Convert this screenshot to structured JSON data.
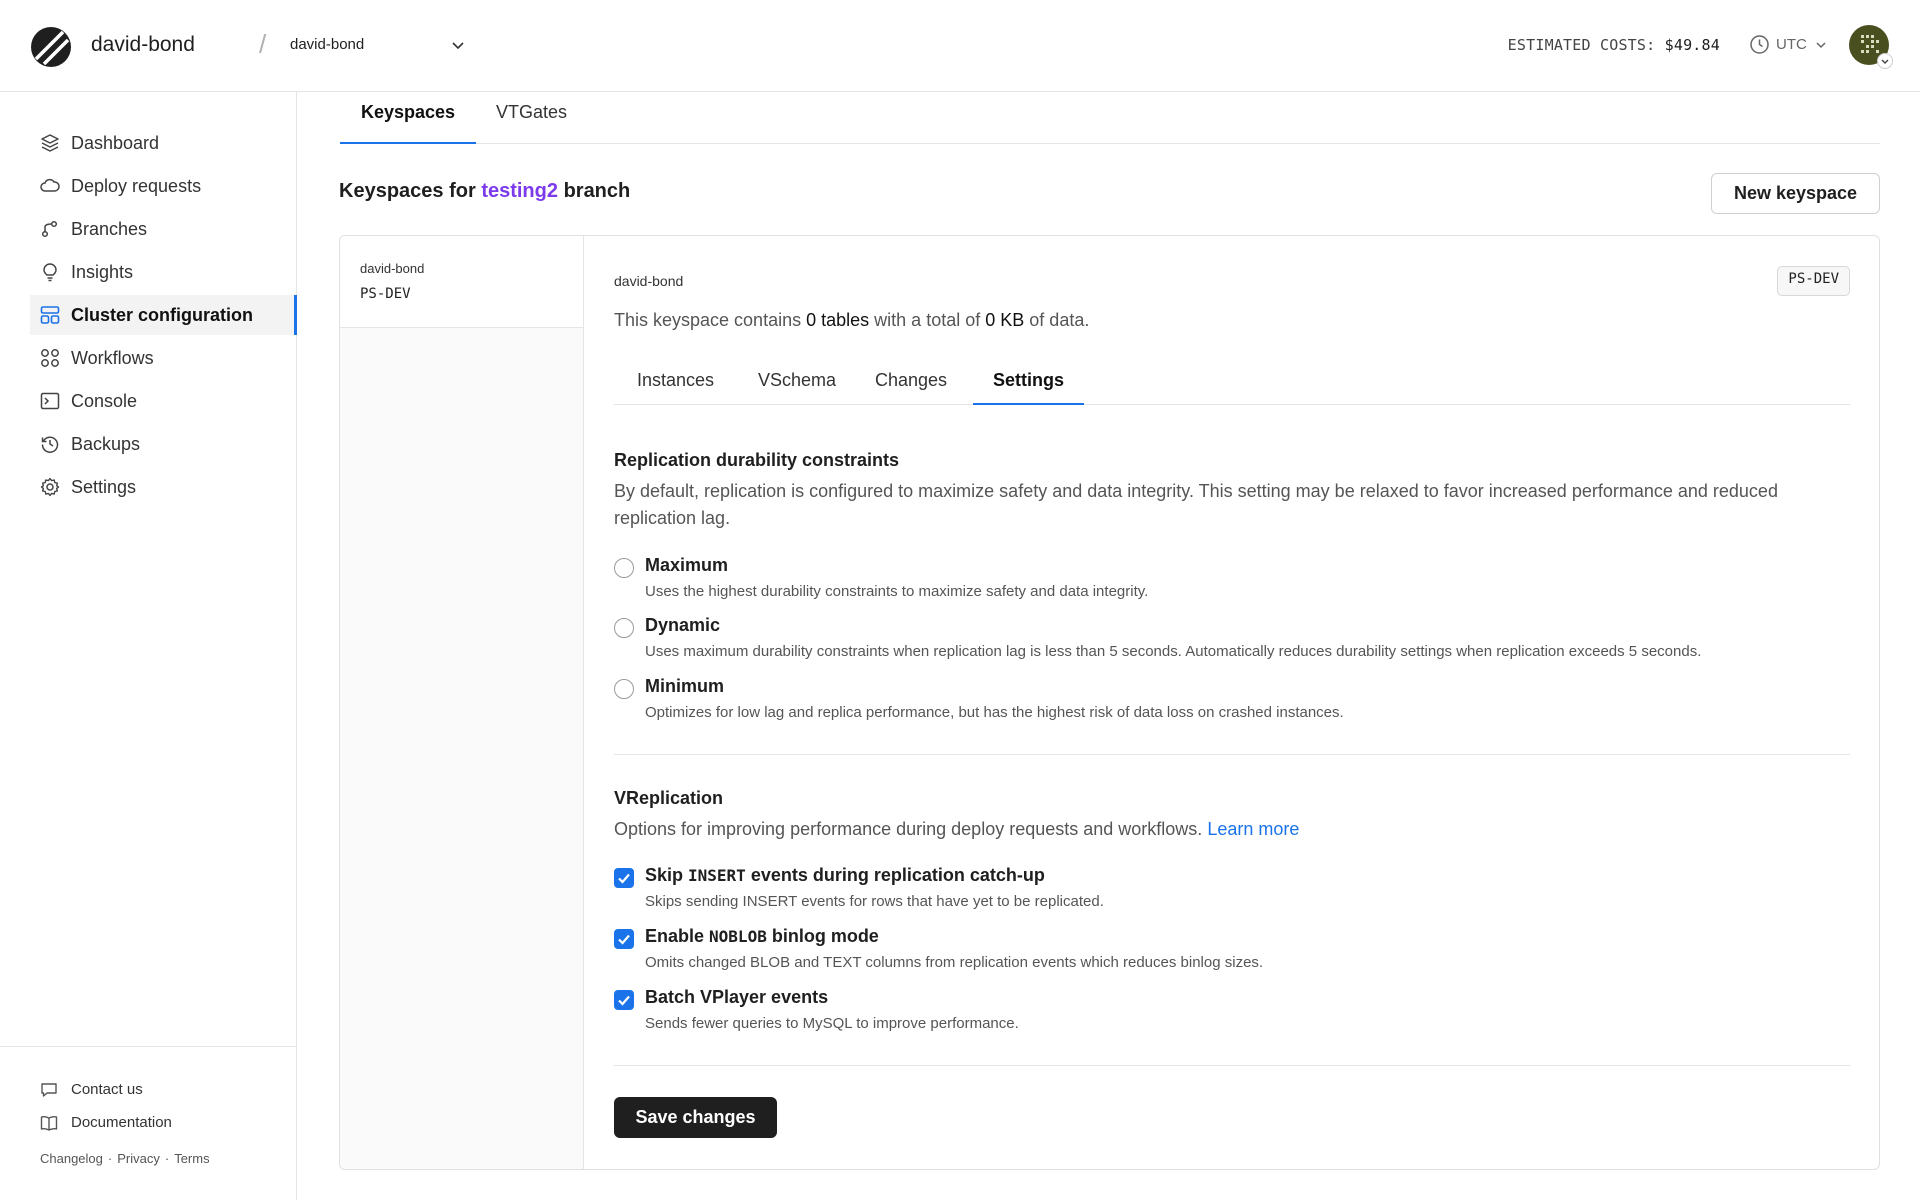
{
  "header": {
    "org_name": "david-bond",
    "separator": "/",
    "database_select": "david-bond",
    "costs_label": "ESTIMATED COSTS:",
    "costs_value": "$49.84",
    "timezone": "UTC",
    "colors": {
      "accent": "#1a73e8",
      "branch": "#7c3aed"
    }
  },
  "sidebar": {
    "items": [
      {
        "label": "Dashboard",
        "icon": "layers-icon"
      },
      {
        "label": "Deploy requests",
        "icon": "cloud-icon"
      },
      {
        "label": "Branches",
        "icon": "branch-icon"
      },
      {
        "label": "Insights",
        "icon": "lightbulb-icon"
      },
      {
        "label": "Cluster configuration",
        "icon": "cluster-icon",
        "active": true
      },
      {
        "label": "Workflows",
        "icon": "workflows-icon"
      },
      {
        "label": "Console",
        "icon": "terminal-icon"
      },
      {
        "label": "Backups",
        "icon": "history-icon"
      },
      {
        "label": "Settings",
        "icon": "gear-icon"
      }
    ],
    "footer": {
      "contact": "Contact us",
      "documentation": "Documentation",
      "changelog": "Changelog",
      "privacy": "Privacy",
      "terms": "Terms",
      "dot": "·"
    }
  },
  "main": {
    "tabs": [
      {
        "label": "Keyspaces",
        "active": true
      },
      {
        "label": "VTGates"
      }
    ],
    "heading_prefix": "Keyspaces for",
    "heading_branch": "testing2",
    "heading_suffix": "branch",
    "new_keyspace_button": "New keyspace"
  },
  "keyspace_list": [
    {
      "name": "david-bond",
      "tag": "PS-DEV"
    }
  ],
  "keyspace": {
    "name": "david-bond",
    "badge": "PS-DEV",
    "summary_prefix": "This keyspace contains",
    "tables": "0 tables",
    "summary_mid": "with a total of",
    "size": "0 KB",
    "summary_suffix": "of data.",
    "tabs": [
      {
        "label": "Instances"
      },
      {
        "label": "VSchema"
      },
      {
        "label": "Changes"
      },
      {
        "label": "Settings",
        "active": true
      }
    ]
  },
  "durability": {
    "title": "Replication durability constraints",
    "description": "By default, replication is configured to maximize safety and data integrity. This setting may be relaxed to favor increased performance and reduced replication lag.",
    "options": [
      {
        "label": "Maximum",
        "description": "Uses the highest durability constraints to maximize safety and data integrity.",
        "selected": false
      },
      {
        "label": "Dynamic",
        "description": "Uses maximum durability constraints when replication lag is less than 5 seconds. Automatically reduces durability settings when replication exceeds 5 seconds.",
        "selected": false
      },
      {
        "label": "Minimum",
        "description": "Optimizes for low lag and replica performance, but has the highest risk of data loss on crashed instances.",
        "selected": false
      }
    ]
  },
  "vreplication": {
    "title": "VReplication",
    "description": "Options for improving performance during deploy requests and workflows.",
    "learn_more": "Learn more",
    "options": [
      {
        "label_pre": "Skip ",
        "label_code": "INSERT",
        "label_post": " events during replication catch-up",
        "description": "Skips sending INSERT events for rows that have yet to be replicated.",
        "checked": true
      },
      {
        "label_pre": "Enable ",
        "label_code": "NOBLOB",
        "label_post": " binlog mode",
        "description": "Omits changed BLOB and TEXT columns from replication events which reduces binlog sizes.",
        "checked": true
      },
      {
        "label_pre": "Batch VPlayer events",
        "label_code": "",
        "label_post": "",
        "description": "Sends fewer queries to MySQL to improve performance.",
        "checked": true
      }
    ]
  },
  "save_button": "Save changes"
}
